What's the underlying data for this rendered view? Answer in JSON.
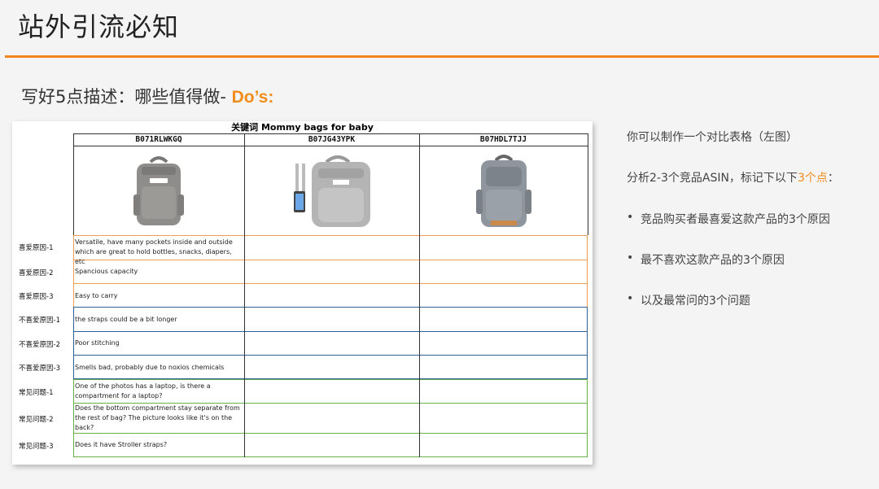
{
  "page": {
    "title": "站外引流必知",
    "subtitle_prefix": "写好5点描述：哪些值得做- ",
    "subtitle_emphasis": "Do’s:"
  },
  "sheet": {
    "title": "关键词 Mommy bags for baby",
    "columns": [
      "B071RLWKGQ",
      "B07JG43YPK",
      "B07HDL7TJJ"
    ],
    "rows": [
      {
        "label": "喜爱原因-1",
        "text": "Versatile, have many pockets inside and outside which are great to hold bottles, snacks, diapers, etc",
        "group": "like"
      },
      {
        "label": "喜爱原因-2",
        "text": "Spancious capacity",
        "group": "like"
      },
      {
        "label": "喜爱原因-3",
        "text": "Easy to carry",
        "group": "like"
      },
      {
        "label": "不喜爱原因-1",
        "text": "the straps could be a bit longer",
        "group": "dislike"
      },
      {
        "label": "不喜爱原因-2",
        "text": "Poor stitching",
        "group": "dislike"
      },
      {
        "label": "不喜爱原因-3",
        "text": "Smells bad, probably due to noxios chemicals",
        "group": "dislike"
      },
      {
        "label": "常见问题-1",
        "text": "One of the photos has a laptop, is there a compartment for a laptop?",
        "group": "faq"
      },
      {
        "label": "常见问题-2",
        "text": "Does the bottom compartment stay separate from the rest of bag? The picture looks like it's on the back?",
        "group": "faq"
      },
      {
        "label": "常见问题-3",
        "text": "Does it have Stroller straps?",
        "group": "faq"
      }
    ],
    "group_colors": {
      "like": "#f0a050",
      "dislike": "#2f5f99",
      "faq": "#69b04a"
    }
  },
  "notes": {
    "line1": "你可以制作一个对比表格（左图）",
    "line2_prefix": "分析2-3个竞品ASIN，标记下以下",
    "line2_highlight": "3个点",
    "line2_suffix": "：",
    "bullets": [
      "竞品购买者最喜爱这款产品的3个原因",
      "最不喜欢这款产品的3个原因",
      "以及最常问的3个问题"
    ],
    "bullet_char": "•"
  },
  "colors": {
    "accent": "#f0861c"
  }
}
